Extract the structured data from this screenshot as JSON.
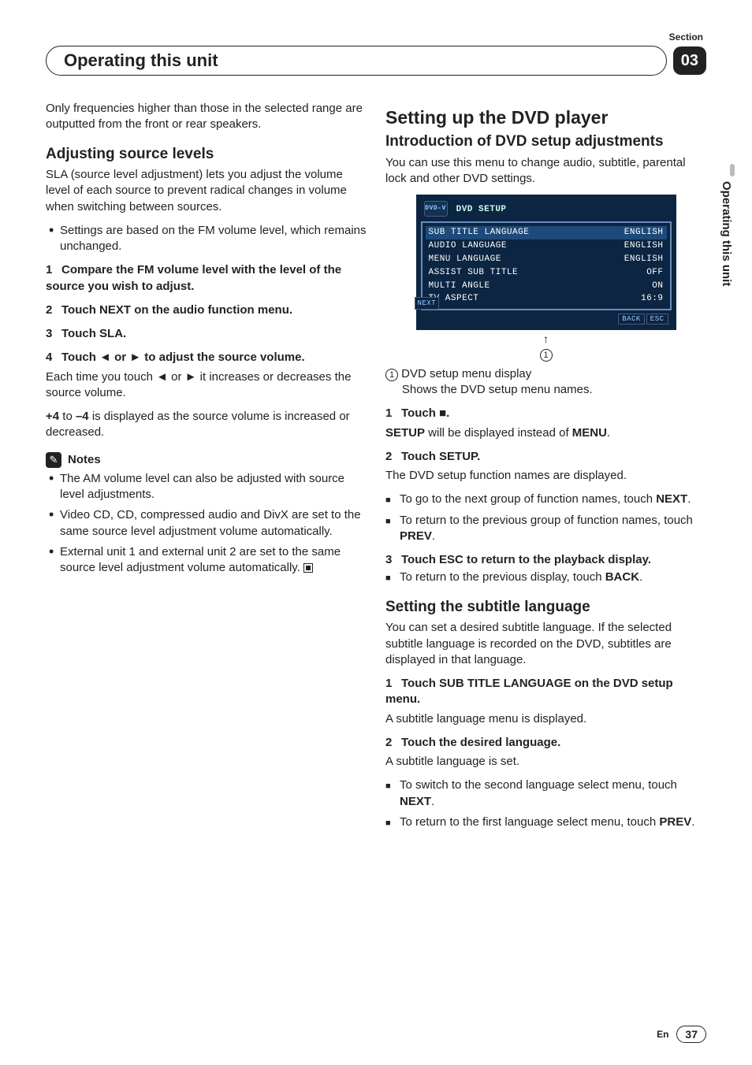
{
  "section_label": "Section",
  "section_number": "03",
  "header_title": "Operating this unit",
  "side_tab": "Operating this unit",
  "footer": {
    "lang": "En",
    "page": "37"
  },
  "left": {
    "intro_p": "Only frequencies higher than those in the selected range are outputted from the front or rear speakers.",
    "h2_adjust": "Adjusting source levels",
    "adjust_p": "SLA (source level adjustment) lets you adjust the volume level of each source to prevent radical changes in volume when switching between sources.",
    "adjust_b1": "Settings are based on the FM volume level, which remains unchanged.",
    "s1": "Compare the FM volume level with the level of the source you wish to adjust.",
    "s2": "Touch NEXT on the audio function menu.",
    "s3": "Touch SLA.",
    "s4_pre": "Touch ",
    "s4_mid": " or ",
    "s4_post": " to adjust the source volume.",
    "s4_p1_pre": "Each time you touch ",
    "s4_p1_mid": " or ",
    "s4_p1_post": " it increases or decreases the source volume.",
    "s4_p2_a": "+4",
    "s4_p2_b": " to ",
    "s4_p2_c": "–4",
    "s4_p2_d": " is displayed as the source volume is increased or decreased.",
    "notes_label": "Notes",
    "n1": "The AM volume level can also be adjusted with source level adjustments.",
    "n2": "Video CD, CD, compressed audio and DivX are set to the same source level adjustment volume automatically.",
    "n3": "External unit 1 and external unit 2 are set to the same source level adjustment volume automatically."
  },
  "right": {
    "h1": "Setting up the DVD player",
    "h2_intro": "Introduction of DVD setup adjustments",
    "intro_p": "You can use this menu to change audio, subtitle, parental lock and other DVD settings.",
    "shot": {
      "title": "DVD SETUP",
      "dvd_label": "DVD-V",
      "next": "NEXT",
      "rows": [
        {
          "l": "SUB TITLE LANGUAGE",
          "r": "ENGLISH",
          "hl": true
        },
        {
          "l": "AUDIO LANGUAGE",
          "r": "ENGLISH"
        },
        {
          "l": "MENU LANGUAGE",
          "r": "ENGLISH"
        },
        {
          "l": "ASSIST SUB TITLE",
          "r": "OFF"
        },
        {
          "l": "MULTI ANGLE",
          "r": "ON"
        },
        {
          "l": "TV ASPECT",
          "r": "16:9"
        }
      ],
      "back": "BACK",
      "esc": "ESC"
    },
    "cap1a": "DVD setup menu display",
    "cap1b": "Shows the DVD setup menu names.",
    "r1_pre": "Touch ",
    "r1_post": ".",
    "r1_p_a": "SETUP",
    "r1_p_b": " will be displayed instead of ",
    "r1_p_c": "MENU",
    "r1_p_d": ".",
    "r2": "Touch SETUP.",
    "r2_p": "The DVD setup function names are displayed.",
    "r2_b1_a": "To go to the next group of function names, touch ",
    "r2_b1_b": "NEXT",
    "r2_b1_c": ".",
    "r2_b2_a": "To return to the previous group of function names, touch ",
    "r2_b2_b": "PREV",
    "r2_b2_c": ".",
    "r3": "Touch ESC to return to the playback display.",
    "r3_b_a": "To return to the previous display, touch ",
    "r3_b_b": "BACK",
    "r3_b_c": ".",
    "h2_sub": "Setting the subtitle language",
    "sub_p": "You can set a desired subtitle language. If the selected subtitle language is recorded on the DVD, subtitles are displayed in that language.",
    "sub_s1": "Touch SUB TITLE LANGUAGE on the DVD setup menu.",
    "sub_s1_p": "A subtitle language menu is displayed.",
    "sub_s2": "Touch the desired language.",
    "sub_s2_p": "A subtitle language is set.",
    "sub_b1_a": "To switch to the second language select menu, touch ",
    "sub_b1_b": "NEXT",
    "sub_b1_c": ".",
    "sub_b2_a": "To return to the first language select menu, touch ",
    "sub_b2_b": "PREV",
    "sub_b2_c": "."
  }
}
